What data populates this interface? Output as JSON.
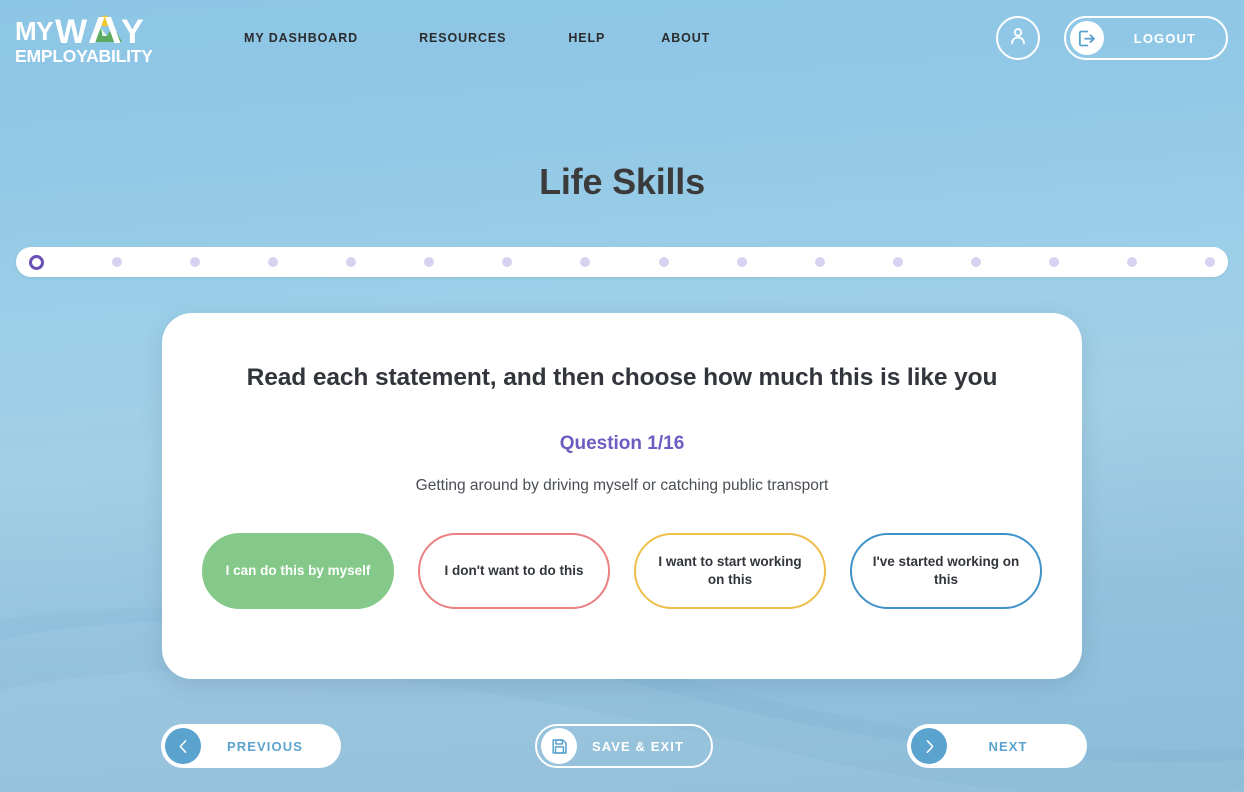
{
  "brand": {
    "line1_part1": "MY",
    "line1_part2": "W",
    "line1_part3": "Y",
    "line2": "EMPLOYABILITY",
    "logo_icon": "mountain-sun-icon"
  },
  "nav": {
    "items": [
      {
        "label": "MY DASHBOARD",
        "name": "nav-my-dashboard"
      },
      {
        "label": "RESOURCES",
        "name": "nav-resources"
      },
      {
        "label": "HELP",
        "name": "nav-help"
      },
      {
        "label": "ABOUT",
        "name": "nav-about"
      }
    ]
  },
  "account": {
    "avatar_icon": "user-icon",
    "logout_icon": "logout-arrow-icon",
    "logout_label": "LOGOUT"
  },
  "page": {
    "title": "Life Skills"
  },
  "progress": {
    "total_steps": 16,
    "current_step": 1,
    "dot_color": "#d6d3f0",
    "current_ring_color": "#6a51b5"
  },
  "card": {
    "heading": "Read each statement, and then choose how much this is like you",
    "question_counter": "Question 1/16",
    "question_text": "Getting around by driving myself or catching public transport",
    "counter_color": "#6f5cc0"
  },
  "answers": [
    {
      "label": "I can do this by myself",
      "state": "selected",
      "color": "#84c98a",
      "name": "answer-can-do-by-myself"
    },
    {
      "label": "I don't want to do this",
      "state": "unselected",
      "color": "#ea8080",
      "name": "answer-dont-want-to-do"
    },
    {
      "label": "I want to start working on this",
      "state": "unselected",
      "color": "#edbe49",
      "name": "answer-want-to-start-working"
    },
    {
      "label": "I've started working on this",
      "state": "unselected",
      "color": "#3f93c8",
      "name": "answer-started-working"
    }
  ],
  "footer": {
    "previous_label": "PREVIOUS",
    "previous_icon": "chevron-left-icon",
    "save_label": "SAVE & EXIT",
    "save_icon": "floppy-disk-icon",
    "next_label": "NEXT",
    "next_icon": "chevron-right-icon"
  },
  "theme": {
    "background_top": "#8dc5e6",
    "background_bottom": "#8bbcd8",
    "accent_blue": "#5aa3ce"
  }
}
